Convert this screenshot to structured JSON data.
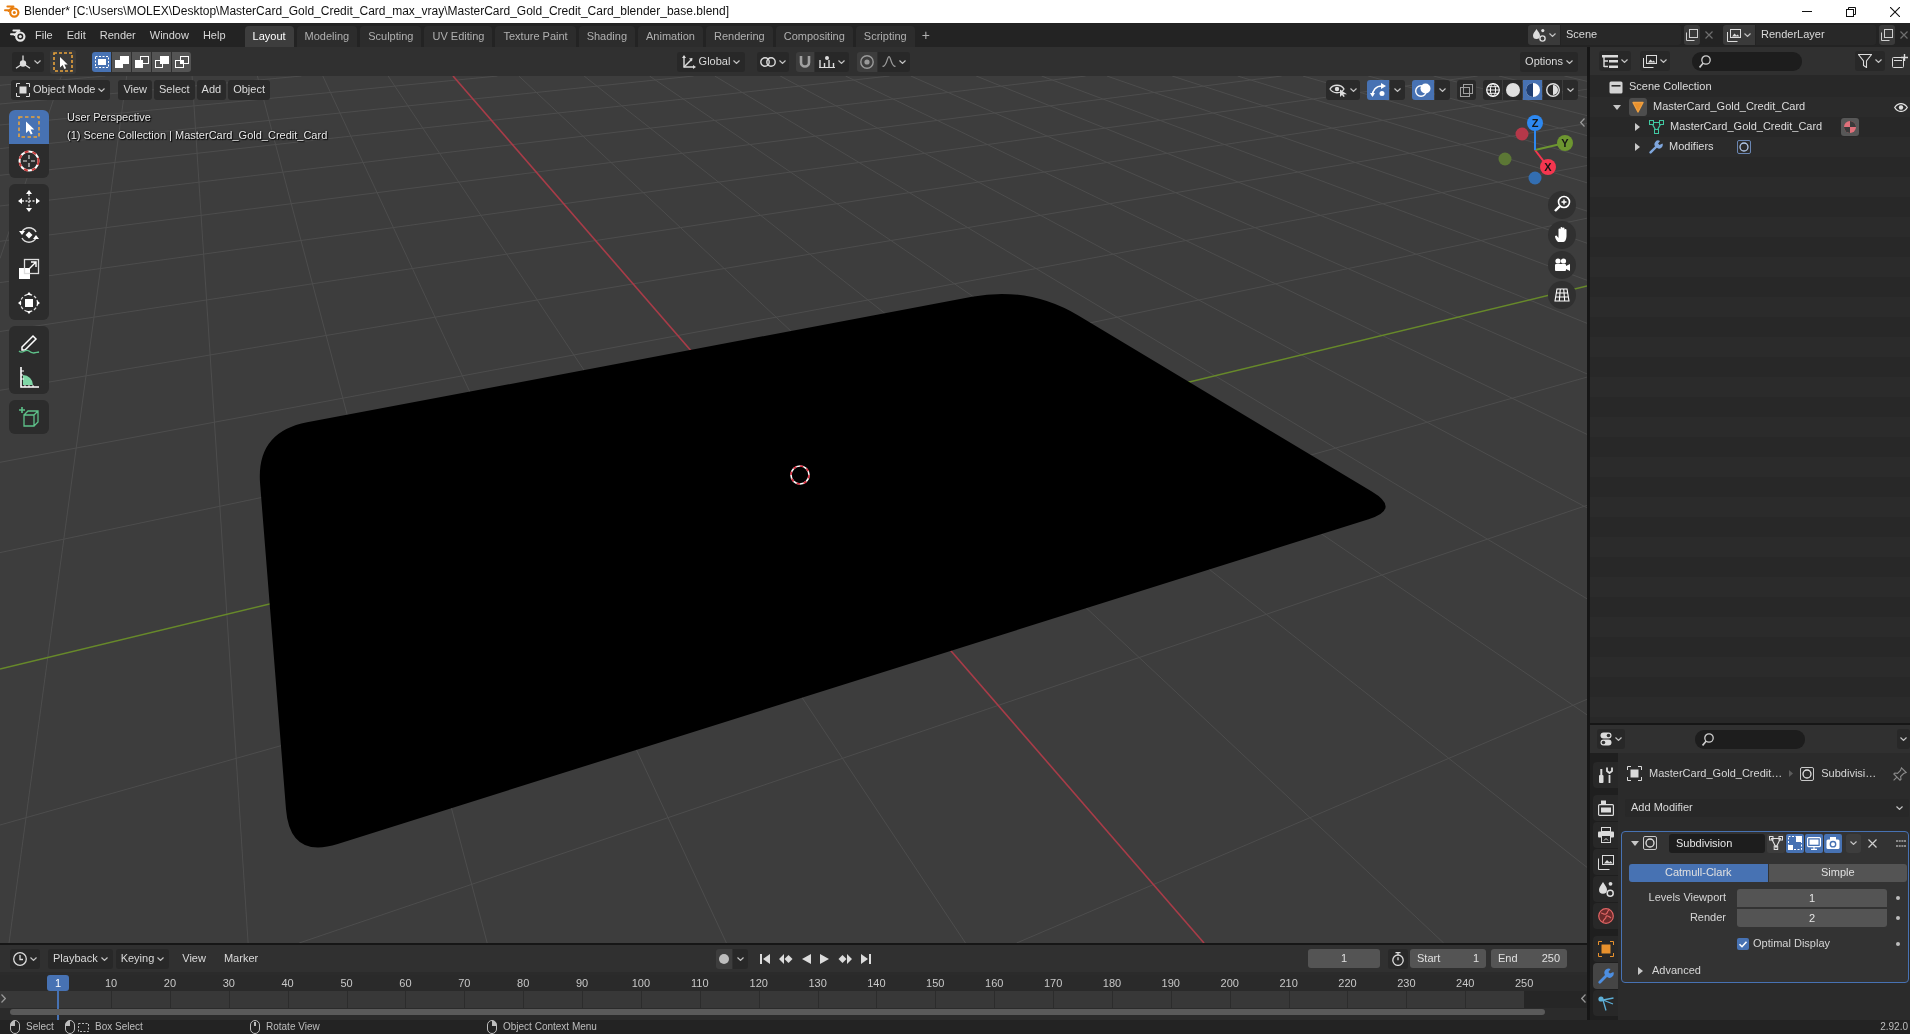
{
  "window": {
    "title": "Blender* [C:\\Users\\MOLEX\\Desktop\\MasterCard_Gold_Credit_Card_max_vray\\MasterCard_Gold_Credit_Card_blender_base.blend]"
  },
  "menu": [
    "File",
    "Edit",
    "Render",
    "Window",
    "Help"
  ],
  "workspaces": [
    {
      "label": "Layout",
      "selected": true
    },
    {
      "label": "Modeling",
      "selected": false
    },
    {
      "label": "Sculpting",
      "selected": false
    },
    {
      "label": "UV Editing",
      "selected": false
    },
    {
      "label": "Texture Paint",
      "selected": false
    },
    {
      "label": "Shading",
      "selected": false
    },
    {
      "label": "Animation",
      "selected": false
    },
    {
      "label": "Rendering",
      "selected": false
    },
    {
      "label": "Compositing",
      "selected": false
    },
    {
      "label": "Scripting",
      "selected": false
    }
  ],
  "add_workspace": "+",
  "scene": "Scene",
  "view_layer": "RenderLayer",
  "tool_settings": {
    "select_modes": [
      {
        "kind": "set",
        "selected": true
      },
      {
        "kind": "extend",
        "selected": false
      },
      {
        "kind": "subtract",
        "selected": false
      },
      {
        "kind": "invert",
        "selected": false
      },
      {
        "kind": "intersect",
        "selected": false
      }
    ],
    "orientation": "Global",
    "snap": false,
    "proportional_editing": false,
    "options": "Options"
  },
  "viewport_header": {
    "mode": "Object Mode",
    "menus": [
      "View",
      "Select",
      "Add",
      "Object"
    ],
    "show_gizmos": true,
    "show_overlays": true,
    "xray": false,
    "shading": [
      {
        "kind": "wireframe",
        "selected": false
      },
      {
        "kind": "solid",
        "selected": false
      },
      {
        "kind": "material",
        "selected": true
      },
      {
        "kind": "rendered",
        "selected": false
      }
    ]
  },
  "viewport": {
    "view_name": "User Perspective",
    "context": "(1) Scene Collection | MasterCard_Gold_Credit_Card",
    "tools": [
      {
        "kind": "select_box",
        "selected": true
      },
      {
        "kind": "cursor",
        "selected": false
      },
      {
        "kind": "move",
        "selected": false
      },
      {
        "kind": "rotate",
        "selected": false
      },
      {
        "kind": "scale",
        "selected": false
      },
      {
        "kind": "transform",
        "selected": false
      },
      {
        "kind": "annotate",
        "selected": false
      },
      {
        "kind": "measure",
        "selected": false
      },
      {
        "kind": "add_cube",
        "selected": false
      }
    ],
    "gizmo_axes": [
      {
        "label": "X",
        "color": "#f5364f"
      },
      {
        "label": "Y",
        "color": "#6d9630"
      },
      {
        "label": "Z",
        "color": "#2d88f0"
      }
    ]
  },
  "outliner": {
    "tree": [
      {
        "label": "Scene Collection",
        "kind": "collection",
        "children": [
          {
            "label": "MasterCard_Gold_Credit_Card",
            "kind": "object",
            "expanded": true,
            "visible": true,
            "children": [
              {
                "label": "MasterCard_Gold_Credit_Card",
                "kind": "mesh",
                "expanded": false
              },
              {
                "label": "Modifiers",
                "kind": "modifiers",
                "expanded": false
              }
            ]
          }
        ]
      }
    ]
  },
  "properties": {
    "tabs": [
      {
        "kind": "tool",
        "selected": false
      },
      {
        "kind": "render",
        "selected": false
      },
      {
        "kind": "output",
        "selected": false
      },
      {
        "kind": "view_layer",
        "selected": false
      },
      {
        "kind": "scene",
        "selected": false
      },
      {
        "kind": "world",
        "selected": false
      },
      {
        "kind": "object",
        "selected": false
      },
      {
        "kind": "modifiers",
        "selected": true
      },
      {
        "kind": "particles",
        "selected": false
      }
    ],
    "breadcrumb": [
      "MasterCard_Gold_Credit…",
      "Subdivisi…"
    ],
    "add_modifier": "Add Modifier",
    "modifiers": [
      {
        "name": "Subdivision",
        "expanded": true,
        "show_on_cage": false,
        "show_in_editmode": true,
        "show_viewport": true,
        "show_render": true,
        "algorithms": [
          {
            "label": "Catmull-Clark",
            "selected": true
          },
          {
            "label": "Simple",
            "selected": false
          }
        ],
        "fields": [
          {
            "label": "Levels Viewport",
            "value": "1"
          },
          {
            "label": "Render",
            "value": "2"
          }
        ],
        "options": [
          {
            "label": "Optimal Display",
            "checked": true
          }
        ],
        "sections": [
          {
            "label": "Advanced",
            "expanded": false
          }
        ]
      }
    ]
  },
  "timeline": {
    "menus": [
      {
        "label": "Playback",
        "kind": "dropdown"
      },
      {
        "label": "Keying",
        "kind": "dropdown"
      },
      {
        "label": "View",
        "kind": "menu"
      },
      {
        "label": "Marker",
        "kind": "menu"
      }
    ],
    "auto_keying": false,
    "current_frame": "1",
    "start": {
      "label": "Start",
      "value": "1"
    },
    "end": {
      "label": "End",
      "value": "250"
    },
    "playhead": "1",
    "frame_labels": [
      "10",
      "20",
      "30",
      "40",
      "50",
      "60",
      "70",
      "80",
      "90",
      "100",
      "110",
      "120",
      "130",
      "140",
      "150",
      "160",
      "170",
      "180",
      "190",
      "200",
      "210",
      "220",
      "230",
      "240",
      "250"
    ]
  },
  "status_bar": {
    "hints": [
      {
        "kind": "mouse_left",
        "label": "Select"
      },
      {
        "kind": "mouse_drag",
        "label": "Box Select"
      },
      {
        "kind": "mouse_middle",
        "label": "Rotate View"
      },
      {
        "kind": "mouse_right",
        "label": "Object Context Menu"
      }
    ],
    "version": "2.92.0"
  }
}
